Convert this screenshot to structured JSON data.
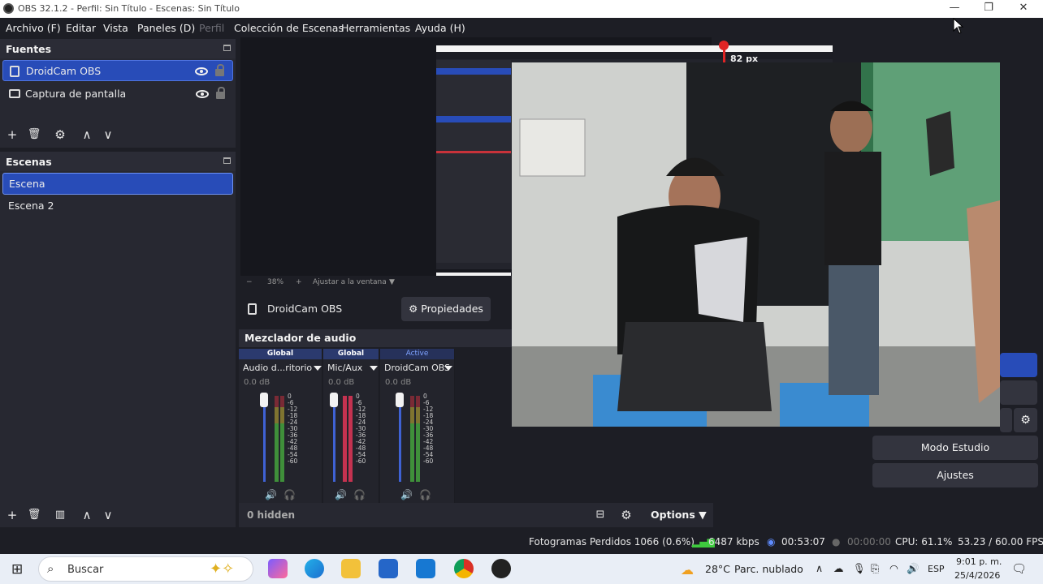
{
  "window": {
    "title": "OBS 32.1.2 - Perfil: Sin Título - Escenas: Sin Título",
    "minimize_glyph": "—",
    "restore_glyph": "❐",
    "close_glyph": "✕"
  },
  "menu": {
    "items": [
      "Archivo (F)",
      "Editar",
      "Vista",
      "Paneles (D)",
      "Perfil",
      "Colección de Escenas",
      "Herramientas",
      "Ayuda (H)"
    ]
  },
  "sources": {
    "title": "Fuentes",
    "items": [
      {
        "label": "DroidCam OBS",
        "icon": "source-file-icon",
        "selected": true
      },
      {
        "label": "Captura de pantalla",
        "icon": "monitor-icon",
        "selected": false
      }
    ]
  },
  "scenes": {
    "title": "Escenas",
    "items": [
      {
        "label": "Escena",
        "selected": true
      },
      {
        "label": "Escena 2",
        "selected": false
      }
    ]
  },
  "toolbar": {
    "add": "+",
    "remove": "🗑",
    "settings": "⚙",
    "up": "∧",
    "down": "∨",
    "filters": "▥"
  },
  "preview": {
    "guide_label": "82 px",
    "zoom_minus": "−",
    "zoom_value": "38%",
    "zoom_plus": "+",
    "fit_label": "Ajustar a la ventana"
  },
  "context_bar": {
    "source_name": "DroidCam OBS",
    "properties_label": "Propiedades"
  },
  "mixer": {
    "title": "Mezclador de audio",
    "channels": [
      {
        "tag": "Global",
        "name": "Audio d...ritorio",
        "db": "0.0 dB",
        "level": 0.88,
        "hot": false
      },
      {
        "tag": "Global",
        "name": "Mic/Aux",
        "db": "0.0 dB",
        "level": 0.92,
        "hot": true
      },
      {
        "tag": "Active",
        "name": "DroidCam OBS",
        "db": "0.0 dB",
        "level": 0.88,
        "hot": false
      }
    ],
    "scale_ticks": [
      "0",
      "-6",
      "-12",
      "-18",
      "-24",
      "-30",
      "-36",
      "-42",
      "-48",
      "-54",
      "-60"
    ],
    "hidden_label": "0 hidden",
    "options_label": "Options"
  },
  "controls": {
    "studio_mode": "Modo Estudio",
    "settings": "Ajustes"
  },
  "status": {
    "dropped_frames": "Fotogramas Perdidos 1066 (0.6%)",
    "bitrate": "6487 kbps",
    "stream_time": "00:53:07",
    "record_time": "00:00:00",
    "cpu": "CPU: 61.1%",
    "fps": "53.23 / 60.00 FPS"
  },
  "taskbar": {
    "search_placeholder": "Buscar",
    "weather_temp": "28°C",
    "weather_desc": "Parc. nublado",
    "language": "ESP",
    "time": "9:01 p. m.",
    "date": "25/4/2026"
  }
}
